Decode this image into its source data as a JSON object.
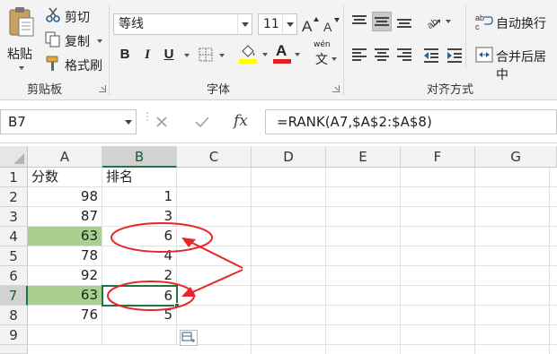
{
  "ribbon": {
    "clipboard": {
      "paste_label": "粘贴",
      "cut_label": "剪切",
      "copy_label": "复制",
      "format_painter_label": "格式刷",
      "group_label": "剪贴板"
    },
    "font": {
      "font_name": "等线",
      "font_size": "11",
      "bold": "B",
      "italic": "I",
      "underline": "U",
      "font_color_glyph": "A",
      "pinyin_top": "wén",
      "pinyin_bottom": "文",
      "group_label": "字体",
      "font_color": "#e02020",
      "fill_color": "#ffff00"
    },
    "alignment": {
      "wrap_text_label": "自动换行",
      "merge_center_label": "合并后居中",
      "group_label": "对齐方式"
    }
  },
  "formula_bar": {
    "name_box": "B7",
    "formula": "=RANK(A7,$A$2:$A$8)"
  },
  "sheet": {
    "columns": [
      "A",
      "B",
      "C",
      "D",
      "E",
      "F",
      "G"
    ],
    "rows": [
      {
        "num": "1",
        "a": "分数",
        "b": "排名"
      },
      {
        "num": "2",
        "a": "98",
        "b": "1"
      },
      {
        "num": "3",
        "a": "87",
        "b": "3"
      },
      {
        "num": "4",
        "a": "63",
        "b": "6"
      },
      {
        "num": "5",
        "a": "78",
        "b": "4"
      },
      {
        "num": "6",
        "a": "92",
        "b": "2"
      },
      {
        "num": "7",
        "a": "63",
        "b": "6"
      },
      {
        "num": "8",
        "a": "76",
        "b": "5"
      },
      {
        "num": "9",
        "a": "",
        "b": ""
      }
    ],
    "highlight_color": "#a9d08e",
    "annotation_color": "#e8262a"
  }
}
